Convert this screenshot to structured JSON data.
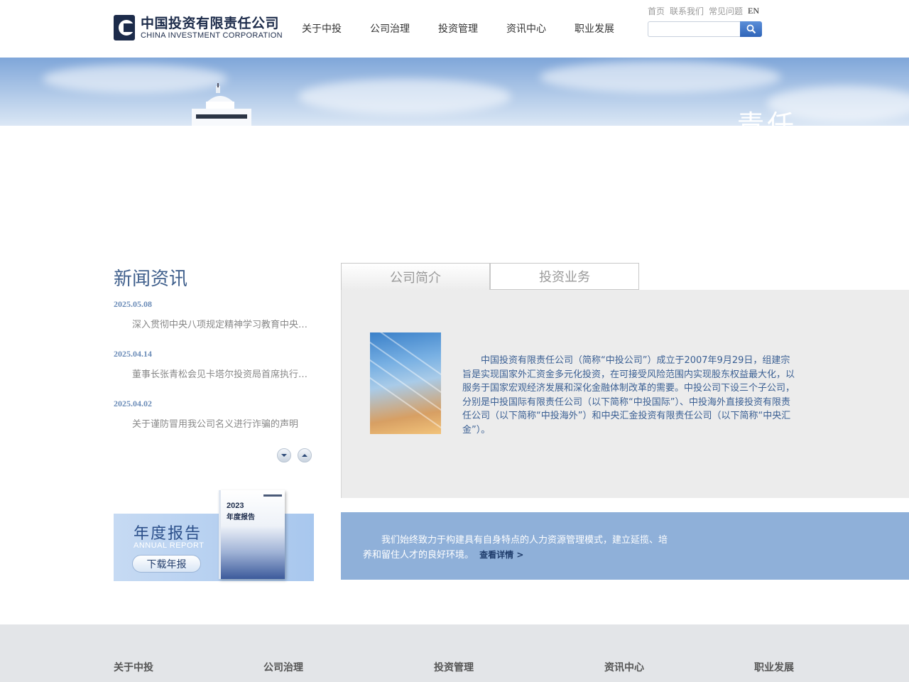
{
  "header": {
    "logo_cn": "中国投资有限责任公司",
    "logo_en": "CHINA INVESTMENT CORPORATION",
    "nav": [
      "关于中投",
      "公司治理",
      "投资管理",
      "资讯中心",
      "职业发展"
    ],
    "top_links": [
      "首页",
      "联系我们",
      "常见问题"
    ],
    "lang_link": "EN",
    "search_placeholder": ""
  },
  "banner": {
    "title": "责任"
  },
  "news": {
    "title": "新闻资讯",
    "items": [
      {
        "date": "2025.05.08",
        "text": "深入贯彻中央八项规定精神学习教育中央…"
      },
      {
        "date": "2025.04.14",
        "text": "董事长张青松会见卡塔尔投资局首席执行…"
      },
      {
        "date": "2025.04.02",
        "text": "关于谨防冒用我公司名义进行诈骗的声明"
      }
    ]
  },
  "annual_report": {
    "title_cn": "年度报告",
    "title_en": "ANNUAL REPORT",
    "button": "下载年报",
    "book_year": "2023",
    "book_title": "年度报告"
  },
  "tabs": {
    "items": [
      "公司简介",
      "投资业务"
    ],
    "active_text": "中国投资有限责任公司（简称“中投公司”）成立于2007年9月29日，组建宗旨是实现国家外汇资金多元化投资，在可接受风险范围内实现股东权益最大化，以服务于国家宏观经济发展和深化金融体制改革的需要。中投公司下设三个子公司，分别是中投国际有限责任公司（以下简称“中投国际”）、中投海外直接投资有限责任公司（以下简称“中投海外”）和中央汇金投资有限责任公司（以下简称“中央汇金”）。"
  },
  "career": {
    "text": "我们始终致力于构建具有自身特点的人力资源管理模式，建立延揽、培养和留住人才的良好环境。",
    "link": "查看详情 >"
  },
  "footer": {
    "items": [
      "关于中投",
      "公司治理",
      "投资管理",
      "资讯中心",
      "职业发展"
    ]
  },
  "colors": {
    "brand_navy": "#1c2b4a",
    "news_title": "#3f5f8c",
    "career_bg": "#8fb0d9",
    "tab_panel_bg": "#ececec"
  }
}
